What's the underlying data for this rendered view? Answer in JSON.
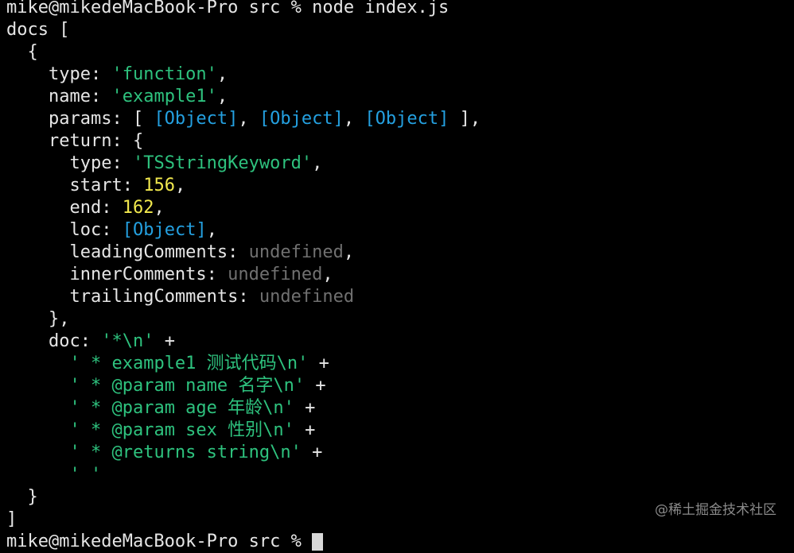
{
  "terminal": {
    "prompt_line": "mike@mikedeMacBook-Pro src % node index.js",
    "lines": [
      {
        "indent": "",
        "parts": [
          {
            "t": "docs [",
            "c": "plain"
          }
        ]
      },
      {
        "indent": "  ",
        "parts": [
          {
            "t": "{",
            "c": "plain"
          }
        ]
      },
      {
        "indent": "    ",
        "parts": [
          {
            "t": "type: ",
            "c": "plain"
          },
          {
            "t": "'function'",
            "c": "str"
          },
          {
            "t": ",",
            "c": "plain"
          }
        ]
      },
      {
        "indent": "    ",
        "parts": [
          {
            "t": "name: ",
            "c": "plain"
          },
          {
            "t": "'example1'",
            "c": "str"
          },
          {
            "t": ",",
            "c": "plain"
          }
        ]
      },
      {
        "indent": "    ",
        "parts": [
          {
            "t": "params: [ ",
            "c": "plain"
          },
          {
            "t": "[Object]",
            "c": "obj"
          },
          {
            "t": ", ",
            "c": "plain"
          },
          {
            "t": "[Object]",
            "c": "obj"
          },
          {
            "t": ", ",
            "c": "plain"
          },
          {
            "t": "[Object]",
            "c": "obj"
          },
          {
            "t": " ],",
            "c": "plain"
          }
        ]
      },
      {
        "indent": "    ",
        "parts": [
          {
            "t": "return: {",
            "c": "plain"
          }
        ]
      },
      {
        "indent": "      ",
        "parts": [
          {
            "t": "type: ",
            "c": "plain"
          },
          {
            "t": "'TSStringKeyword'",
            "c": "str"
          },
          {
            "t": ",",
            "c": "plain"
          }
        ]
      },
      {
        "indent": "      ",
        "parts": [
          {
            "t": "start: ",
            "c": "plain"
          },
          {
            "t": "156",
            "c": "num"
          },
          {
            "t": ",",
            "c": "plain"
          }
        ]
      },
      {
        "indent": "      ",
        "parts": [
          {
            "t": "end: ",
            "c": "plain"
          },
          {
            "t": "162",
            "c": "num"
          },
          {
            "t": ",",
            "c": "plain"
          }
        ]
      },
      {
        "indent": "      ",
        "parts": [
          {
            "t": "loc: ",
            "c": "plain"
          },
          {
            "t": "[Object]",
            "c": "obj"
          },
          {
            "t": ",",
            "c": "plain"
          }
        ]
      },
      {
        "indent": "      ",
        "parts": [
          {
            "t": "leadingComments: ",
            "c": "plain"
          },
          {
            "t": "undefined",
            "c": "undef"
          },
          {
            "t": ",",
            "c": "plain"
          }
        ]
      },
      {
        "indent": "      ",
        "parts": [
          {
            "t": "innerComments: ",
            "c": "plain"
          },
          {
            "t": "undefined",
            "c": "undef"
          },
          {
            "t": ",",
            "c": "plain"
          }
        ]
      },
      {
        "indent": "      ",
        "parts": [
          {
            "t": "trailingComments: ",
            "c": "plain"
          },
          {
            "t": "undefined",
            "c": "undef"
          }
        ]
      },
      {
        "indent": "    ",
        "parts": [
          {
            "t": "},",
            "c": "plain"
          }
        ]
      },
      {
        "indent": "    ",
        "parts": [
          {
            "t": "doc: ",
            "c": "plain"
          },
          {
            "t": "'*\\n'",
            "c": "str"
          },
          {
            "t": " +",
            "c": "plain"
          }
        ]
      },
      {
        "indent": "      ",
        "parts": [
          {
            "t": "' * example1 测试代码\\n'",
            "c": "str"
          },
          {
            "t": " +",
            "c": "plain"
          }
        ]
      },
      {
        "indent": "      ",
        "parts": [
          {
            "t": "' * @param name 名字\\n'",
            "c": "str"
          },
          {
            "t": " +",
            "c": "plain"
          }
        ]
      },
      {
        "indent": "      ",
        "parts": [
          {
            "t": "' * @param age 年龄\\n'",
            "c": "str"
          },
          {
            "t": " +",
            "c": "plain"
          }
        ]
      },
      {
        "indent": "      ",
        "parts": [
          {
            "t": "' * @param sex 性别\\n'",
            "c": "str"
          },
          {
            "t": " +",
            "c": "plain"
          }
        ]
      },
      {
        "indent": "      ",
        "parts": [
          {
            "t": "' * @returns string\\n'",
            "c": "str"
          },
          {
            "t": " +",
            "c": "plain"
          }
        ]
      },
      {
        "indent": "      ",
        "parts": [
          {
            "t": "' '",
            "c": "str"
          }
        ]
      },
      {
        "indent": "  ",
        "parts": [
          {
            "t": "}",
            "c": "plain"
          }
        ]
      },
      {
        "indent": "",
        "parts": [
          {
            "t": "]",
            "c": "plain"
          }
        ]
      }
    ],
    "next_prompt": "mike@mikedeMacBook-Pro src % "
  },
  "watermark": "@稀土掘金技术社区",
  "colors": {
    "background": "#000000",
    "text": "#e6e6e6",
    "string": "#2ec27e",
    "number": "#f2e94e",
    "object": "#24a0e0",
    "undefined": "#707070"
  }
}
